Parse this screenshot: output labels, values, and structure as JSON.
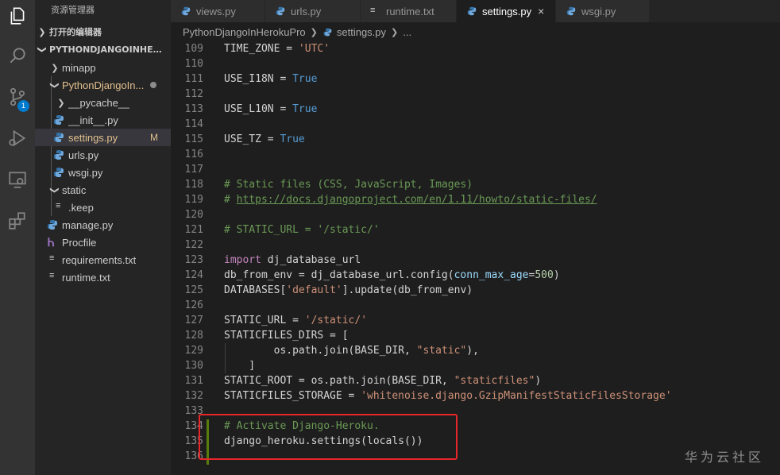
{
  "activity_bar": {
    "scm_badge": "1"
  },
  "sidebar": {
    "title": "资源管理器",
    "open_editors_label": "打开的编辑器",
    "project_label": "PYTHONDJANGOINHEROK...",
    "items": [
      {
        "label": "minapp"
      },
      {
        "label": "PythonDjangoIn..."
      },
      {
        "label": "__pycache__"
      },
      {
        "label": "__init__.py"
      },
      {
        "label": "settings.py",
        "status": "M"
      },
      {
        "label": "urls.py"
      },
      {
        "label": "wsgi.py"
      },
      {
        "label": "static"
      },
      {
        "label": ".keep"
      },
      {
        "label": "manage.py"
      },
      {
        "label": "Procfile"
      },
      {
        "label": "requirements.txt"
      },
      {
        "label": "runtime.txt"
      }
    ]
  },
  "tabs": [
    {
      "label": "views.py"
    },
    {
      "label": "urls.py"
    },
    {
      "label": "runtime.txt"
    },
    {
      "label": "settings.py",
      "close": "×"
    },
    {
      "label": "wsgi.py"
    }
  ],
  "breadcrumb": {
    "project": "PythonDjangoInHerokuPro",
    "file": "settings.py",
    "more": "..."
  },
  "editor": {
    "lines": {
      "l109": {
        "n": "109",
        "a": "TIME_ZONE = ",
        "b": "'UTC'"
      },
      "l110": {
        "n": "110"
      },
      "l111": {
        "n": "111",
        "a": "USE_I18N = ",
        "b": "True"
      },
      "l112": {
        "n": "112"
      },
      "l113": {
        "n": "113",
        "a": "USE_L10N = ",
        "b": "True"
      },
      "l114": {
        "n": "114"
      },
      "l115": {
        "n": "115",
        "a": "USE_TZ = ",
        "b": "True"
      },
      "l116": {
        "n": "116"
      },
      "l117": {
        "n": "117"
      },
      "l118": {
        "n": "118",
        "c": "# Static files (CSS, JavaScript, Images)"
      },
      "l119": {
        "n": "119",
        "c": "# ",
        "link": "https://docs.djangoproject.com/en/1.11/howto/static-files/"
      },
      "l120": {
        "n": "120"
      },
      "l121": {
        "n": "121",
        "c": "# STATIC_URL = '/static/'"
      },
      "l122": {
        "n": "122"
      },
      "l123": {
        "n": "123",
        "kw": "import",
        "a": " dj_database_url"
      },
      "l124": {
        "n": "124",
        "a": "db_from_env = dj_database_url.config(",
        "p": "conn_max_age",
        "eq": "=",
        "num": "500",
        "end": ")"
      },
      "l125": {
        "n": "125",
        "a": "DATABASES[",
        "b": "'default'",
        "end": "].update(db_from_env)"
      },
      "l126": {
        "n": "126"
      },
      "l127": {
        "n": "127",
        "a": "STATIC_URL = ",
        "b": "'/static/'"
      },
      "l128": {
        "n": "128",
        "a": "STATICFILES_DIRS = ["
      },
      "l129": {
        "n": "129",
        "a": "        os.path.join(BASE_DIR, ",
        "b": "\"static\"",
        "end": "),"
      },
      "l130": {
        "n": "130",
        "a": "    ]"
      },
      "l131": {
        "n": "131",
        "a": "STATIC_ROOT = os.path.join(BASE_DIR, ",
        "b": "\"staticfiles\"",
        "end": ")"
      },
      "l132": {
        "n": "132",
        "a": "STATICFILES_STORAGE = ",
        "b": "'whitenoise.django.GzipManifestStaticFilesStorage'"
      },
      "l133": {
        "n": "133"
      },
      "l134": {
        "n": "134",
        "c": "# Activate Django-Heroku."
      },
      "l135": {
        "n": "135",
        "a": "django_heroku.settings(locals())"
      },
      "l136": {
        "n": "136"
      }
    }
  },
  "watermark": "华为云社区",
  "colors": {
    "highlight_border": "#e8262a",
    "accent": "#007acc",
    "modified": "#e2c08d"
  }
}
